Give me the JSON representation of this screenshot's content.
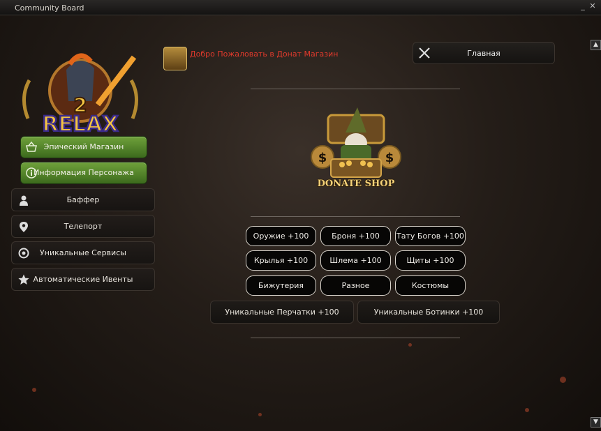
{
  "window": {
    "title": "Community Board"
  },
  "logo": {
    "text": "RELAX",
    "number": "2"
  },
  "sidebar": {
    "items": [
      {
        "label": "Эпический Магазин",
        "icon": "basket-icon",
        "style": "green"
      },
      {
        "label": "Информация Персонажа",
        "icon": "info-icon",
        "style": "green"
      },
      {
        "label": "Баффер",
        "icon": "person-icon",
        "style": "dark"
      },
      {
        "label": "Телепорт",
        "icon": "map-pin-icon",
        "style": "dark"
      },
      {
        "label": "Уникальные Сервисы",
        "icon": "service-icon",
        "style": "dark"
      },
      {
        "label": "Автоматические Ивенты",
        "icon": "star-icon",
        "style": "dark"
      }
    ]
  },
  "header": {
    "welcome": "Добро Пожаловать в Донат Магазин",
    "home_label": "Главная"
  },
  "shop": {
    "logo_text": "DONATE SHOP"
  },
  "categories": [
    "Оружие +100",
    "Броня +100",
    "Тату Богов +100",
    "Крылья +100",
    "Шлема +100",
    "Щиты +100",
    "Бижутерия",
    "Разное",
    "Костюмы"
  ],
  "wide_categories": [
    "Уникальные Перчатки +100",
    "Уникальные Ботинки +100"
  ],
  "colors": {
    "welcome_text": "#e23a2c",
    "green_button": "#5a8a2c"
  }
}
